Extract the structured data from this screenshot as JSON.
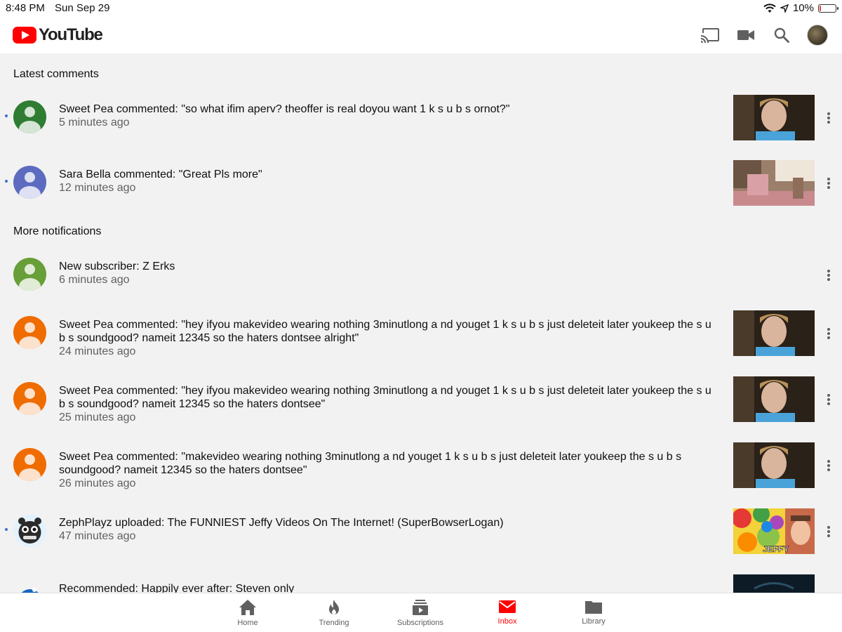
{
  "status_bar": {
    "time": "8:48 PM",
    "date": "Sun Sep 29",
    "battery_text": "10%",
    "battery_level": 0.1
  },
  "header": {
    "logo_text": "YouTube",
    "icons": [
      "cast-icon",
      "video-camera-icon",
      "search-icon",
      "account-avatar"
    ]
  },
  "sections": {
    "latest_title": "Latest comments",
    "more_title": "More notifications"
  },
  "notifications": [
    {
      "text": "Sweet Pea commented: \"so what ifim aperv? theoffer is real doyou want 1 k s u b s ornot?\"",
      "time": "5 minutes ago",
      "unread": true,
      "avatar_color": "#2e7d32"
    },
    {
      "text": "Sara Bella commented: \"Great Pls more\"",
      "time": "12 minutes ago",
      "unread": true,
      "avatar_color": "#5c6bc0"
    },
    {
      "text": "New subscriber: Z Erks",
      "time": "6 minutes ago",
      "unread": false,
      "avatar_color": "#689f38"
    },
    {
      "text": "Sweet Pea commented: \"hey ifyou makevideo wearing nothing 3minutlong a nd youget 1 k s u b s just deleteit later youkeep the s u b s soundgood? nameit 12345 so the haters dontsee alright\"",
      "time": "24 minutes ago",
      "unread": false,
      "avatar_color": "#ef6c00"
    },
    {
      "text": "Sweet Pea commented: \"hey ifyou makevideo wearing nothing 3minutlong a nd youget 1 k s u b s just deleteit later youkeep the s u b s soundgood? nameit 12345 so the haters dontsee\"",
      "time": "25 minutes ago",
      "unread": false,
      "avatar_color": "#ef6c00"
    },
    {
      "text": "Sweet Pea commented: \"makevideo wearing nothing 3minutlong a nd youget 1 k s u b s just deleteit later youkeep the s u b s soundgood? nameit 12345 so the haters dontsee\"",
      "time": "26 minutes ago",
      "unread": false,
      "avatar_color": "#ef6c00"
    },
    {
      "text": "ZephPlayz uploaded: The FUNNIEST Jeffy Videos On The Internet! (SuperBowserLogan)",
      "time": "47 minutes ago",
      "unread": true,
      "avatar_color": "#e3f2fd"
    },
    {
      "text": "Recommended: Happily ever after: Steven only",
      "time": "",
      "unread": false,
      "avatar_color": "#1565c0"
    }
  ],
  "thumb_labels": {
    "jeffy": "JEFFY"
  },
  "bottom_nav": [
    {
      "label": "Home",
      "active": false
    },
    {
      "label": "Trending",
      "active": false
    },
    {
      "label": "Subscriptions",
      "active": false
    },
    {
      "label": "Inbox",
      "active": true
    },
    {
      "label": "Library",
      "active": false
    }
  ],
  "colors": {
    "brand": "#ff0000",
    "unread_dot": "#3e6ecf",
    "secondary_text": "#606060",
    "background": "#f2f2f2"
  }
}
